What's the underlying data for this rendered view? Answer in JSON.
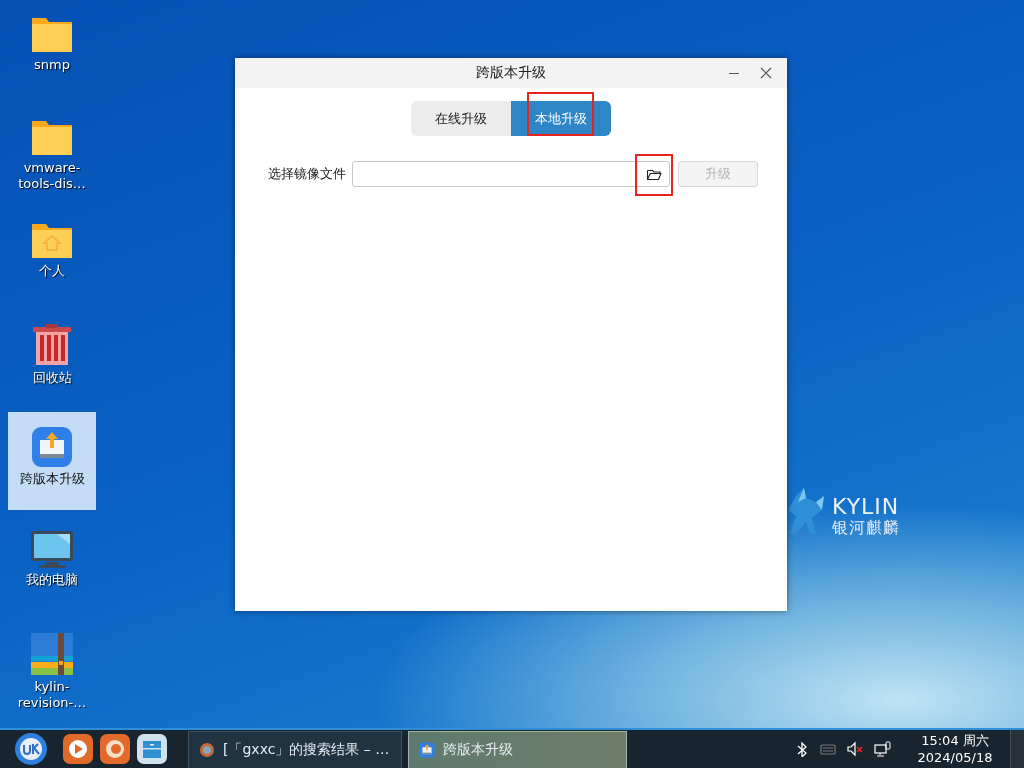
{
  "desktop_icons": [
    {
      "label": "snmp",
      "kind": "folder",
      "selected": false
    },
    {
      "label": "vmware-tools-dis…",
      "kind": "folder",
      "selected": false
    },
    {
      "label": "个人",
      "kind": "home-folder",
      "selected": false
    },
    {
      "label": "回收站",
      "kind": "trash",
      "selected": false
    },
    {
      "label": "跨版本升级",
      "kind": "upgrade-app",
      "selected": true
    },
    {
      "label": "我的电脑",
      "kind": "computer",
      "selected": false
    },
    {
      "label": "kylin-revision-…",
      "kind": "archive",
      "selected": false
    }
  ],
  "wallpaper_logo": {
    "text": "KYLIN",
    "subtext": "银河麒麟"
  },
  "window": {
    "title": "跨版本升级",
    "tabs": [
      {
        "label": "在线升级",
        "selected": false,
        "annotated": false
      },
      {
        "label": "本地升级",
        "selected": true,
        "annotated": true
      }
    ],
    "file_row": {
      "label": "选择镜像文件",
      "browse_annotated": true
    },
    "upgrade_button": {
      "label": "升级",
      "disabled": true
    }
  },
  "taskbar": {
    "tasks": [
      {
        "label": "[「gxxc」的搜索结果 – …",
        "kind": "browser",
        "selected": false
      },
      {
        "label": "跨版本升级",
        "kind": "upgrade-app",
        "selected": true
      }
    ],
    "clock": {
      "time": "15:04 周六",
      "date": "2024/05/18"
    }
  }
}
